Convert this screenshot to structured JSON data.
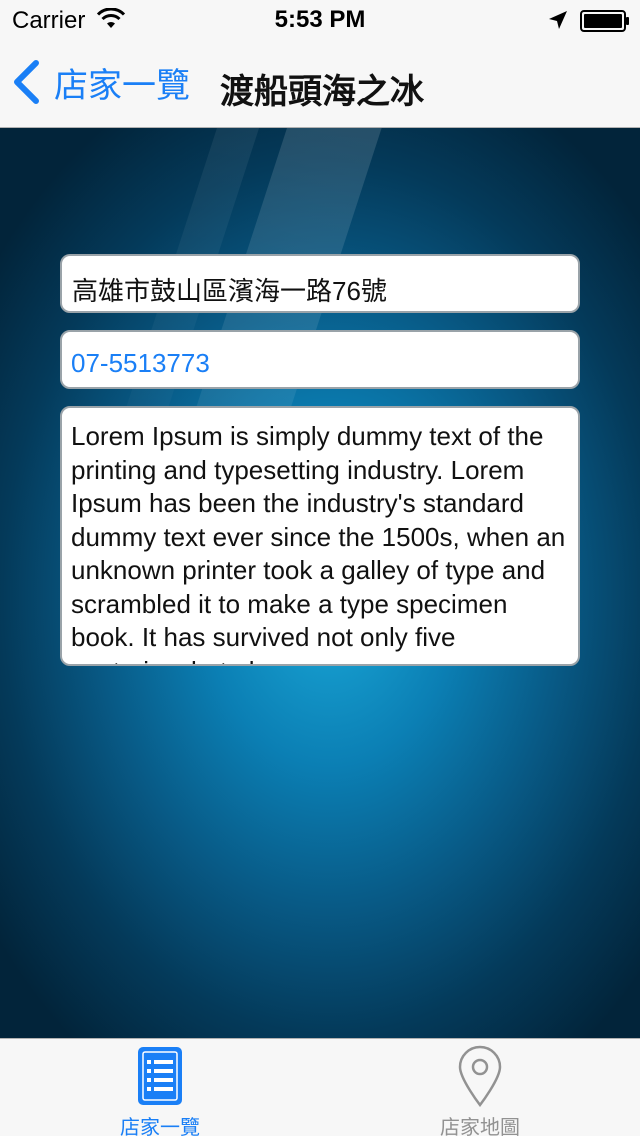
{
  "status_bar": {
    "carrier": "Carrier",
    "time": "5:53 PM"
  },
  "nav": {
    "back_label": "店家一覽",
    "title": "渡船頭海之冰"
  },
  "store": {
    "address": "高雄市鼓山區濱海一路76號",
    "phone": "07-5513773",
    "description": "Lorem Ipsum is simply dummy text of the printing and typesetting industry. Lorem Ipsum has been the industry's standard dummy text ever since the 1500s, when an unknown printer took a galley of type and scrambled it to make a type specimen book. It has survived not only five centuries, but also"
  },
  "tabs": [
    {
      "label": "店家一覽",
      "icon": "list-icon",
      "selected": true
    },
    {
      "label": "店家地圖",
      "icon": "map-pin-icon",
      "selected": false
    }
  ],
  "colors": {
    "accent": "#1a7ff6",
    "inactive": "#929292",
    "background_center": "#1aa8d8",
    "background_edge": "#02243a"
  }
}
